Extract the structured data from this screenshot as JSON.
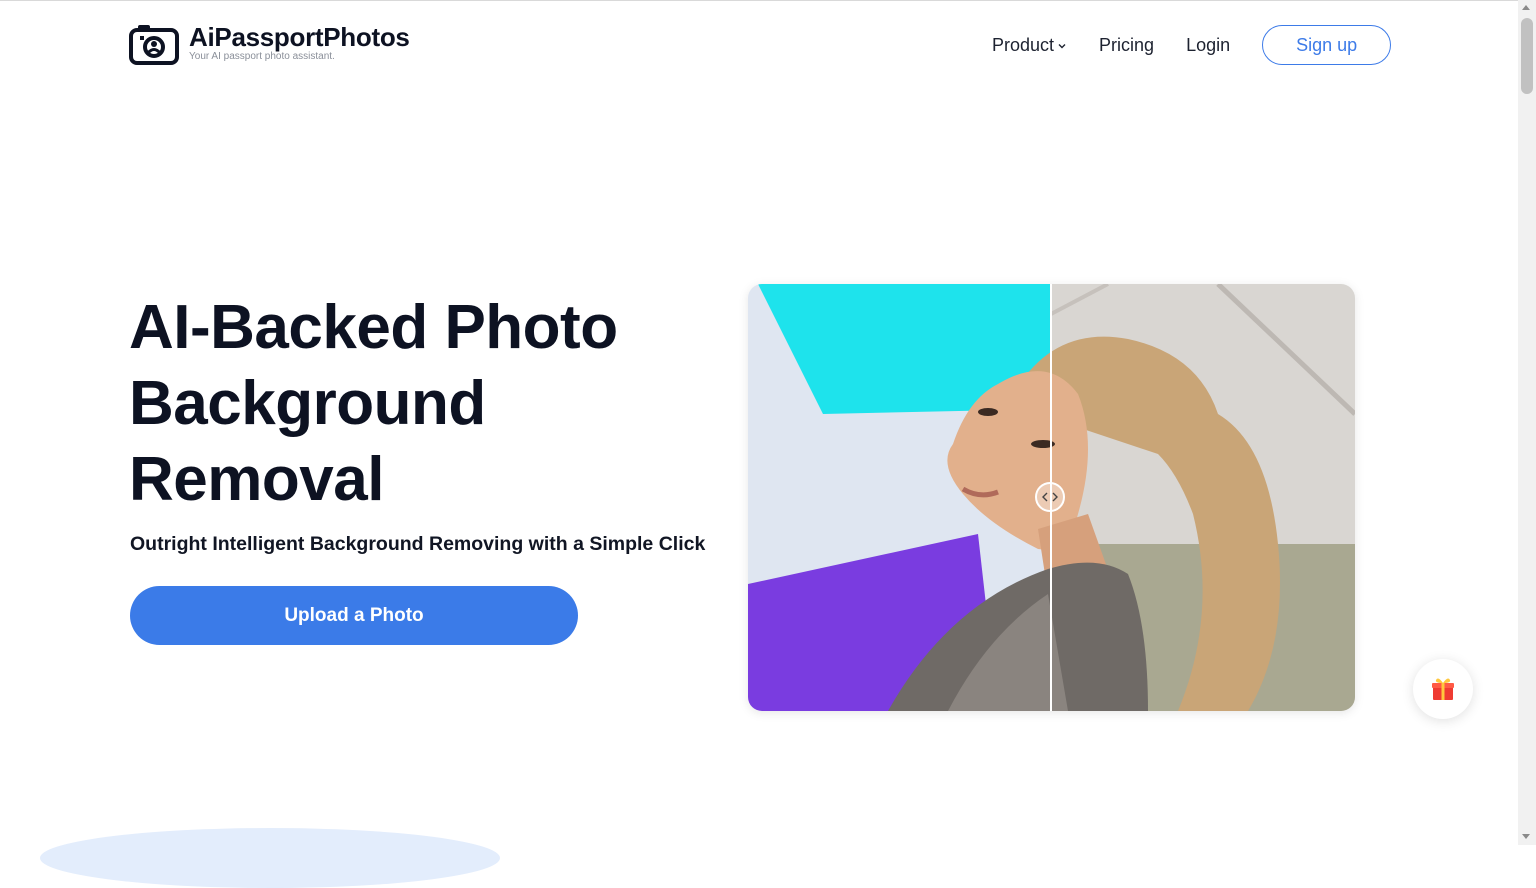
{
  "brand": {
    "name": "AiPassportPhotos",
    "tagline": "Your AI passport photo assistant."
  },
  "nav": {
    "product": "Product",
    "pricing": "Pricing",
    "login": "Login",
    "signup": "Sign up"
  },
  "hero": {
    "headline": "AI-Backed Photo Background Removal",
    "subline": "Outright Intelligent Background Removing with a Simple Click",
    "upload_label": "Upload a Photo"
  },
  "compare": {
    "split_fraction": 0.5
  },
  "colors": {
    "accent": "#3b7be8",
    "cyan_bg": "#1ee3ec",
    "purple_bg": "#7a3ce0"
  }
}
